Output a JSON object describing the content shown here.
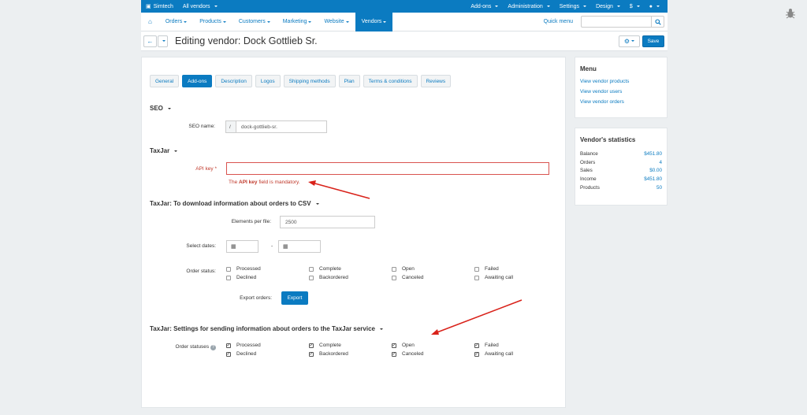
{
  "topbar": {
    "store": "Simtech",
    "vendors": "All vendors",
    "addons": "Add-ons",
    "administration": "Administration",
    "settings": "Settings",
    "design": "Design",
    "currency": "$"
  },
  "nav": {
    "items": [
      "Orders",
      "Products",
      "Customers",
      "Marketing",
      "Website",
      "Vendors"
    ],
    "quick_menu": "Quick menu"
  },
  "header": {
    "title": "Editing vendor: Dock Gottlieb Sr.",
    "save": "Save"
  },
  "tabs": [
    "General",
    "Add-ons",
    "Description",
    "Logos",
    "Shipping methods",
    "Plan",
    "Terms & conditions",
    "Reviews"
  ],
  "seo": {
    "heading": "SEO",
    "name_label": "SEO name:",
    "prefix": "/",
    "value": "dock-gottlieb-sr."
  },
  "taxjar": {
    "heading": "TaxJar",
    "api_label": "API key",
    "req_mark": "*",
    "error_pre": "The ",
    "error_bold": "API key",
    "error_post": " field is mandatory."
  },
  "csv": {
    "heading": "TaxJar: To download information about orders to CSV",
    "elements_label": "Elements per file:",
    "elements_value": "2500",
    "dates_label": "Select dates:",
    "date_sep": "-",
    "status_label": "Order status:",
    "export_label": "Export orders:",
    "export_btn": "Export",
    "statuses": [
      {
        "label": "Processed",
        "checked": false
      },
      {
        "label": "Complete",
        "checked": false
      },
      {
        "label": "Open",
        "checked": false
      },
      {
        "label": "Failed",
        "checked": false
      },
      {
        "label": "Declined",
        "checked": false
      },
      {
        "label": "Backordered",
        "checked": false
      },
      {
        "label": "Canceled",
        "checked": false
      },
      {
        "label": "Awaiting call",
        "checked": false
      }
    ]
  },
  "send": {
    "heading": "TaxJar: Settings for sending information about orders to the TaxJar service",
    "status_label": "Order statuses",
    "statuses": [
      {
        "label": "Processed",
        "checked": true
      },
      {
        "label": "Complete",
        "checked": true
      },
      {
        "label": "Open",
        "checked": true
      },
      {
        "label": "Failed",
        "checked": true
      },
      {
        "label": "Declined",
        "checked": true
      },
      {
        "label": "Backordered",
        "checked": true
      },
      {
        "label": "Canceled",
        "checked": true
      },
      {
        "label": "Awaiting call",
        "checked": true
      }
    ]
  },
  "menu": {
    "heading": "Menu",
    "links": [
      "View vendor products",
      "View vendor users",
      "View vendor orders"
    ]
  },
  "stats": {
    "heading": "Vendor's statistics",
    "rows": [
      {
        "k": "Balance",
        "v": "$451.80"
      },
      {
        "k": "Orders",
        "v": "4"
      },
      {
        "k": "Sales",
        "v": "$0.00"
      },
      {
        "k": "Income",
        "v": "$451.80"
      },
      {
        "k": "Products",
        "v": "50"
      }
    ]
  },
  "colors": {
    "accent": "#0b7bc1",
    "error": "#c0392b",
    "arrow": "#d9221a"
  }
}
